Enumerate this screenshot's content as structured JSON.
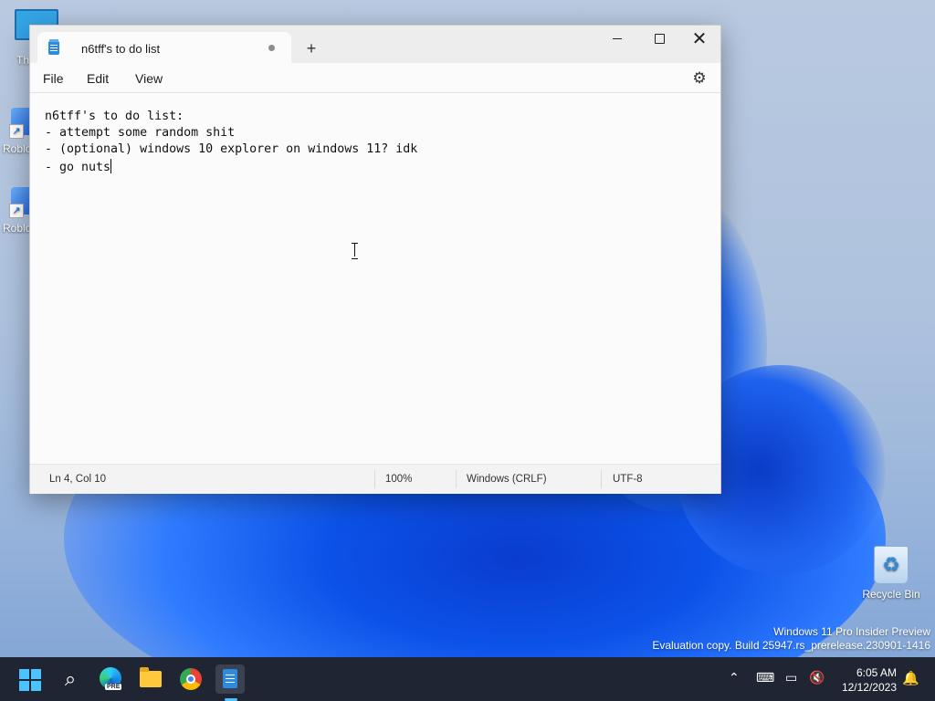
{
  "desktop": {
    "icons": [
      {
        "label": "Th"
      },
      {
        "label": "Roblo"
      },
      {
        "label": "Roblo"
      },
      {
        "label": "Recycle Bin"
      }
    ],
    "watermark": {
      "line1": "Windows 11 Pro Insider Preview",
      "line2": "Evaluation copy. Build 25947.rs_prerelease.230901-1416"
    }
  },
  "notepad": {
    "tab_title": "n6tff's to do list",
    "new_tab_symbol": "+",
    "menu": {
      "file": "File",
      "edit": "Edit",
      "view": "View"
    },
    "content_lines": [
      "n6tff's to do list:",
      "- attempt some random shit",
      "- (optional) windows 10 explorer on windows 11? idk",
      "- go nuts"
    ],
    "status": {
      "position": "Ln 4, Col 10",
      "zoom": "100%",
      "line_ending": "Windows (CRLF)",
      "encoding": "UTF-8"
    },
    "window_buttons": {
      "close": "✕"
    },
    "settings_icon": "⚙"
  },
  "taskbar": {
    "search_glyph": "⌕",
    "edge_badge": "PRE",
    "clock": {
      "time": "6:05 AM",
      "date": "12/12/2023"
    },
    "tray": {
      "chevron": "⌃",
      "network": "⌨",
      "display": "▭",
      "volume": "🔇",
      "bell": "🔔"
    }
  },
  "colors": {
    "accent": "#4cc2ff",
    "taskbar": "#1f2532",
    "notepad_icon": "#2e8bdc"
  }
}
